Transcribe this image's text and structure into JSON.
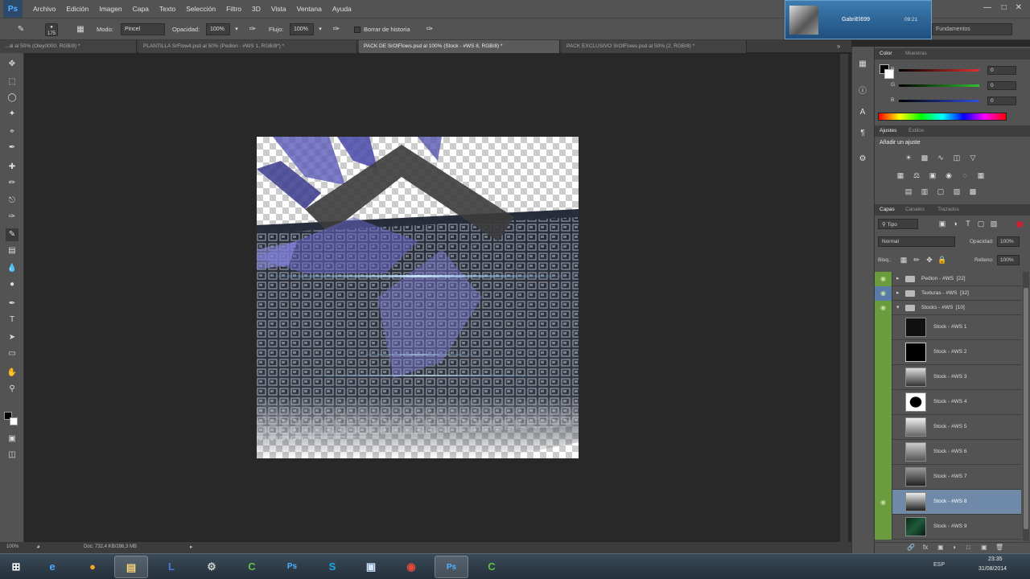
{
  "app": {
    "logo": "Ps"
  },
  "menu": [
    "Archivo",
    "Edición",
    "Imagen",
    "Capa",
    "Texto",
    "Selección",
    "Filtro",
    "3D",
    "Vista",
    "Ventana",
    "Ayuda"
  ],
  "options": {
    "brush_size": "175",
    "mode_label": "Modo:",
    "mode_value": "Pincel",
    "opacity_label": "Opacidad:",
    "opacity_value": "100%",
    "flow_label": "Flujo:",
    "flow_value": "100%",
    "history_label": "Borrar de historia"
  },
  "notification": {
    "user": "GabriEl699",
    "time": "09:21"
  },
  "workspace_select": "Fundamentos",
  "tabs": [
    "...al al 50% (Oley0000, RGB/8) *",
    "PLANTILLA SrFlow4.psd al 50% (Pedion - #WS 1, RGB/8*) *",
    "PACK DE SrOlFlows.psd al 100% (Stock - #WS 8, RGB/8) *",
    "PACK EXCLUSIVO SrOlFlows.psd al 50% (2, RGB/8) *"
  ],
  "status": {
    "zoom": "100%",
    "doc": "Doc: 732,4 KB/286,3 MB"
  },
  "color_panel": {
    "tabs": [
      "Color",
      "Muestras"
    ],
    "channels": [
      {
        "label": "R",
        "value": "0",
        "color": "#e03030"
      },
      {
        "label": "G",
        "value": "0",
        "color": "#30c030"
      },
      {
        "label": "B",
        "value": "0",
        "color": "#3050e0"
      }
    ]
  },
  "adjust_panel": {
    "tabs": [
      "Ajustes",
      "Estilos"
    ],
    "title": "Añadir un ajuste"
  },
  "layers_panel": {
    "tabs": [
      "Capas",
      "Canales",
      "Trazados"
    ],
    "filter": "Tipo",
    "blend": "Normal",
    "opacity_label": "Opacidad:",
    "opacity_value": "100%",
    "lock_label": "Bloq.:",
    "fill_label": "Relleno:",
    "fill_value": "100%",
    "groups": [
      {
        "name": "Pedion - #WS",
        "count": "[22]"
      },
      {
        "name": "Texturas - #WS",
        "count": "[32]"
      },
      {
        "name": "Stocks - #WS",
        "count": "[10]"
      }
    ],
    "layers": [
      "Stock - #WS 1",
      "Stock - #WS 2",
      "Stock - #WS 3",
      "Stock - #WS 4",
      "Stock - #WS 5",
      "Stock - #WS 6",
      "Stock - #WS 7",
      "Stock - #WS 8",
      "Stock - #WS 9"
    ],
    "selected_layer_index": 7
  },
  "taskbar": {
    "lang": "ESP",
    "time": "23:35",
    "date": "31/08/2014",
    "apps": [
      "internet-explorer-icon",
      "media-icon",
      "file-explorer-icon",
      "lol-icon",
      "steam-icon",
      "camtasia-icon",
      "photoshop-icon",
      "skype-icon",
      "window-icon",
      "chrome-icon",
      "photoshop-icon",
      "camtasia-icon"
    ]
  }
}
